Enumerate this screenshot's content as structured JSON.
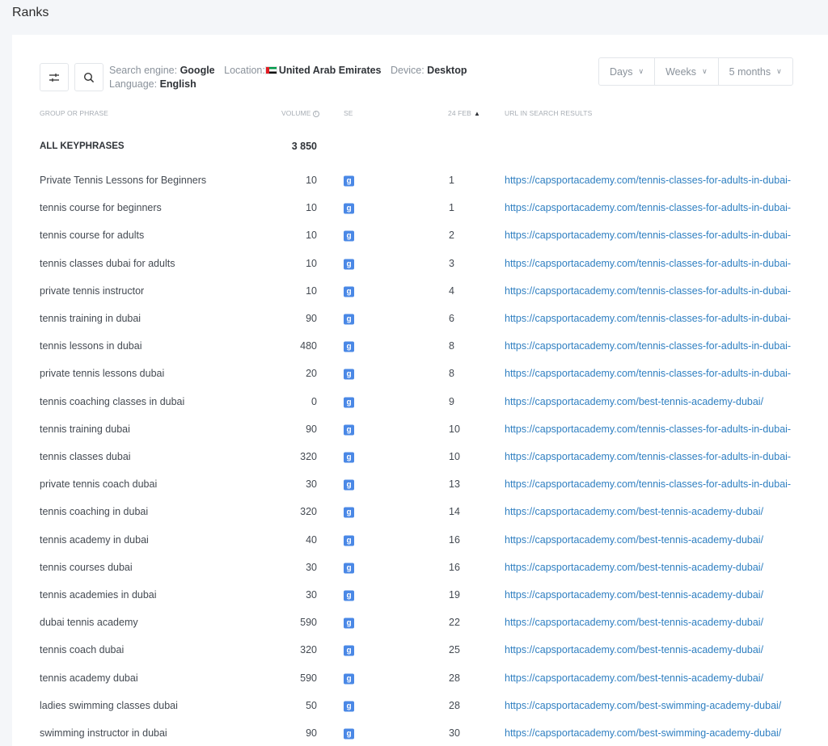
{
  "page_title": "Ranks",
  "toolbar": {
    "filter_icon": "sliders-icon",
    "search_icon": "search-icon",
    "search_engine_label": "Search engine:",
    "search_engine_value": "Google",
    "location_label": "Location:",
    "location_value": "United Arab Emirates",
    "device_label": "Device:",
    "device_value": "Desktop",
    "language_label": "Language:",
    "language_value": "English",
    "period_buttons": [
      "Days",
      "Weeks",
      "5 months"
    ]
  },
  "table": {
    "headers": {
      "phrase": "GROUP OR PHRASE",
      "volume": "VOLUME",
      "se": "SE",
      "date": "24 FEB",
      "url": "URL IN SEARCH RESULTS"
    },
    "total": {
      "label": "ALL KEYPHRASES",
      "volume": "3 850"
    },
    "rows": [
      {
        "phrase": "Private Tennis Lessons for Beginners",
        "volume": "10",
        "pos": "1",
        "url": "https://capsportacademy.com/tennis-classes-for-adults-in-dubai-"
      },
      {
        "phrase": "tennis course for beginners",
        "volume": "10",
        "pos": "1",
        "url": "https://capsportacademy.com/tennis-classes-for-adults-in-dubai-"
      },
      {
        "phrase": "tennis course for adults",
        "volume": "10",
        "pos": "2",
        "url": "https://capsportacademy.com/tennis-classes-for-adults-in-dubai-"
      },
      {
        "phrase": "tennis classes dubai for adults",
        "volume": "10",
        "pos": "3",
        "url": "https://capsportacademy.com/tennis-classes-for-adults-in-dubai-"
      },
      {
        "phrase": "private tennis instructor",
        "volume": "10",
        "pos": "4",
        "url": "https://capsportacademy.com/tennis-classes-for-adults-in-dubai-"
      },
      {
        "phrase": "tennis training in dubai",
        "volume": "90",
        "pos": "6",
        "url": "https://capsportacademy.com/tennis-classes-for-adults-in-dubai-"
      },
      {
        "phrase": "tennis lessons in dubai",
        "volume": "480",
        "pos": "8",
        "url": "https://capsportacademy.com/tennis-classes-for-adults-in-dubai-"
      },
      {
        "phrase": "private tennis lessons dubai",
        "volume": "20",
        "pos": "8",
        "url": "https://capsportacademy.com/tennis-classes-for-adults-in-dubai-"
      },
      {
        "phrase": "tennis coaching classes in dubai",
        "volume": "0",
        "pos": "9",
        "url": "https://capsportacademy.com/best-tennis-academy-dubai/"
      },
      {
        "phrase": "tennis training dubai",
        "volume": "90",
        "pos": "10",
        "url": "https://capsportacademy.com/tennis-classes-for-adults-in-dubai-"
      },
      {
        "phrase": "tennis classes dubai",
        "volume": "320",
        "pos": "10",
        "url": "https://capsportacademy.com/tennis-classes-for-adults-in-dubai-"
      },
      {
        "phrase": "private tennis coach dubai",
        "volume": "30",
        "pos": "13",
        "url": "https://capsportacademy.com/tennis-classes-for-adults-in-dubai-"
      },
      {
        "phrase": "tennis coaching in dubai",
        "volume": "320",
        "pos": "14",
        "url": "https://capsportacademy.com/best-tennis-academy-dubai/"
      },
      {
        "phrase": "tennis academy in dubai",
        "volume": "40",
        "pos": "16",
        "url": "https://capsportacademy.com/best-tennis-academy-dubai/"
      },
      {
        "phrase": "tennis courses dubai",
        "volume": "30",
        "pos": "16",
        "url": "https://capsportacademy.com/best-tennis-academy-dubai/"
      },
      {
        "phrase": "tennis academies in dubai",
        "volume": "30",
        "pos": "19",
        "url": "https://capsportacademy.com/best-tennis-academy-dubai/"
      },
      {
        "phrase": "dubai tennis academy",
        "volume": "590",
        "pos": "22",
        "url": "https://capsportacademy.com/best-tennis-academy-dubai/"
      },
      {
        "phrase": "tennis coach dubai",
        "volume": "320",
        "pos": "25",
        "url": "https://capsportacademy.com/best-tennis-academy-dubai/"
      },
      {
        "phrase": "tennis academy dubai",
        "volume": "590",
        "pos": "28",
        "url": "https://capsportacademy.com/best-tennis-academy-dubai/"
      },
      {
        "phrase": "ladies swimming classes dubai",
        "volume": "50",
        "pos": "28",
        "url": "https://capsportacademy.com/best-swimming-academy-dubai/"
      },
      {
        "phrase": "swimming instructor in dubai",
        "volume": "90",
        "pos": "30",
        "url": "https://capsportacademy.com/best-swimming-academy-dubai/"
      }
    ]
  },
  "colors": {
    "link": "#2f7fc1",
    "google_badge": "#4a88e6",
    "background": "#f4f6f9"
  }
}
